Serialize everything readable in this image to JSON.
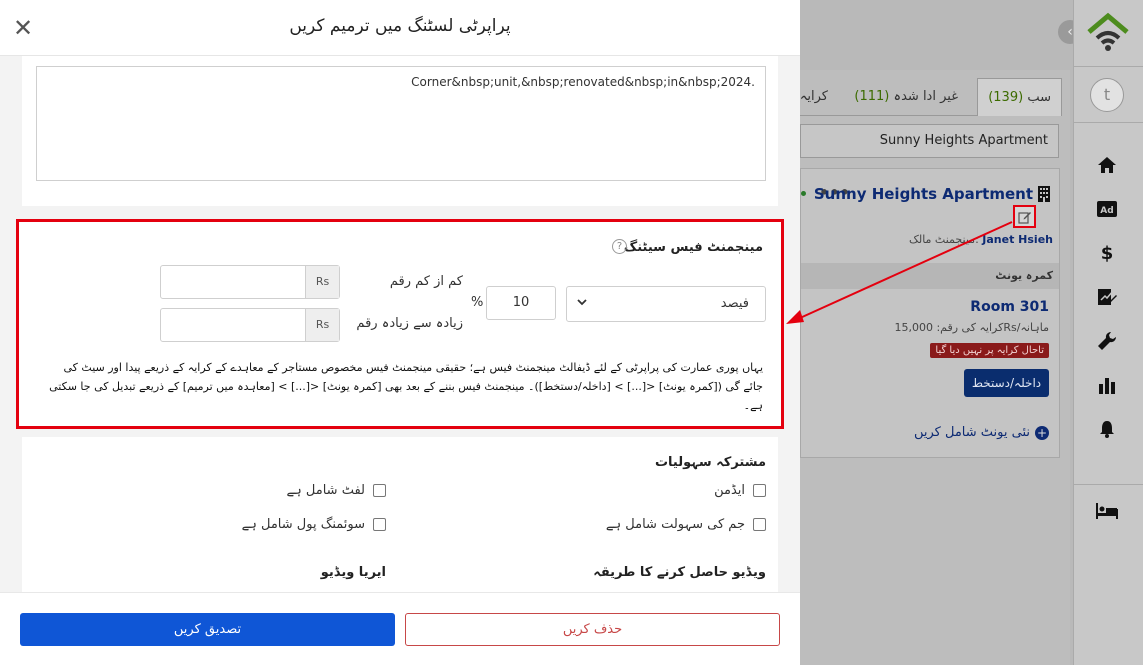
{
  "modal": {
    "title": "پراپرٹی لسٹنگ میں ترمیم کریں",
    "description_value": "Corner&nbsp;unit,&nbsp;renovated&nbsp;in&nbsp;2024.",
    "management_fees": {
      "title": "مینجمنٹ فیس سیٹنگ",
      "type_value": "فیصد",
      "percent_value": "10",
      "percent_sign": "%",
      "min_label": "کم از کم رقم",
      "max_label": "زیادہ سے زیادہ رقم",
      "currency": "Rs",
      "note": "یہاں پوری عمارت کی پراپرٹی کے لئے ڈیفالٹ مینجمنٹ فیس ہے؛ حقیقی مینجمنٹ فیس مخصوص مستاجر کے معاہدے کے کرایہ کے ذریعے پیدا اور سیٹ کی جائے گی ([کمرہ یونٹ] <[...] > [داخلہ/دستخط])۔ مینجمنٹ فیس بننے کے بعد بھی [کمرہ یونٹ] <[...] > [معاہدہ میں ترمیم] کے ذریعے تبدیل کی جا سکتی ہے۔"
    },
    "amenities": {
      "title": "مشترکہ سہولیات",
      "doorman": "ایڈمن",
      "elevator": "لفٹ شامل ہے",
      "gym": "جم کی سہولت شامل ہے",
      "pool": "سوئمنگ پول شامل ہے"
    },
    "video_method_label": "ویڈیو حاصل کرنے کا طریقہ",
    "area_video_label": "ایریا ویڈیو",
    "confirm_label": "تصدیق کریں",
    "delete_label": "حذف کریں"
  },
  "background": {
    "tabs": {
      "all_label": "سب",
      "all_count": "(139)",
      "unpaid_label": "غیر ادا شدہ",
      "unpaid_count": "(111)",
      "rent_label": "کرایہ"
    },
    "search_value": "Sunny Heights Apartment",
    "property": {
      "title": "Sunny Heights Apartment",
      "manager_label": "مینجمنٹ مالک:",
      "manager_name": "Janet Hsieh",
      "units_header": "کمرہ یونٹ",
      "room_title": "Room 301",
      "rent_line": "کرایہ کی رقم: 15,000Rs/ماہانہ",
      "status_badge": "تاحال کرایہ پر نہیں دیا گیا",
      "checkin_label": "داخلہ/دستخط",
      "add_unit_label": "نئی یونٹ شامل کریں"
    },
    "avatar_letter": "t"
  },
  "colors": {
    "primary": "#0f56d6",
    "danger": "#c74747",
    "highlight": "#e4000f",
    "navy": "#0d2a73"
  }
}
